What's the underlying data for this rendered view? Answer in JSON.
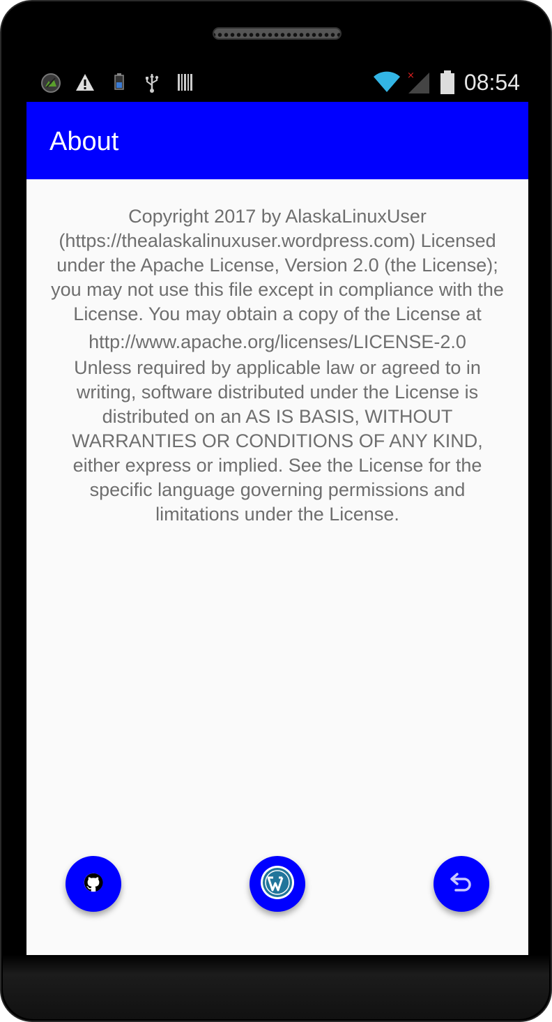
{
  "status_bar": {
    "time": "08:54",
    "left_icons": [
      "app-notification-icon",
      "warning-icon",
      "battery-small-icon",
      "usb-icon",
      "barcode-icon"
    ],
    "right_icons": [
      "wifi-icon",
      "signal-icon",
      "battery-icon"
    ]
  },
  "app_bar": {
    "title": "About",
    "color": "#0000ff"
  },
  "license": {
    "paragraph1": "Copyright 2017 by AlaskaLinuxUser (https://thealaskalinuxuser.wordpress.com) Licensed under the Apache License, Version 2.0 (the License); you may not use this file except in compliance with the License. You may obtain a copy of the License at",
    "url": "http://www.apache.org/licenses/LICENSE-2.0",
    "paragraph2": "Unless required by applicable law or agreed to in writing, software distributed under the License is distributed on an AS IS BASIS, WITHOUT WARRANTIES OR CONDITIONS OF ANY KIND, either express or implied. See the License for the specific language governing permissions and limitations under the License."
  },
  "buttons": {
    "github_icon": "github-icon",
    "wordpress_icon": "wordpress-icon",
    "back_icon": "undo-icon",
    "fab_color": "#0000ff"
  }
}
